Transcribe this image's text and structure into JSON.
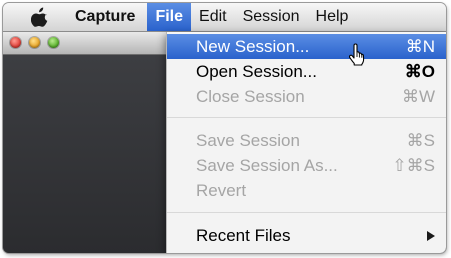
{
  "menubar": {
    "app_name": "Capture",
    "menus": [
      "File",
      "Edit",
      "Session",
      "Help"
    ],
    "open_menu": "File"
  },
  "file_menu": {
    "items": [
      {
        "label": "New Session...",
        "shortcut": "⌘N",
        "enabled": true,
        "highlighted": true
      },
      {
        "label": "Open Session...",
        "shortcut": "⌘O",
        "enabled": true,
        "highlighted": false
      },
      {
        "label": "Close Session",
        "shortcut": "⌘W",
        "enabled": false,
        "highlighted": false
      },
      {
        "label": "Save Session",
        "shortcut": "⌘S",
        "enabled": false,
        "highlighted": false
      },
      {
        "label": "Save Session As...",
        "shortcut": "⇧⌘S",
        "enabled": false,
        "highlighted": false
      },
      {
        "label": "Revert",
        "shortcut": "",
        "enabled": false,
        "highlighted": false
      },
      {
        "label": "Recent Files",
        "shortcut": "",
        "enabled": true,
        "highlighted": false,
        "submenu": true
      }
    ]
  },
  "colors": {
    "highlight": "#3a74d8",
    "disabled_text": "#a5a5a5",
    "window_background": "#3a3b3f"
  },
  "icons": {
    "apple": "apple-logo-icon",
    "cursor": "pointing-hand-cursor-icon",
    "submenu": "submenu-arrow-icon"
  }
}
